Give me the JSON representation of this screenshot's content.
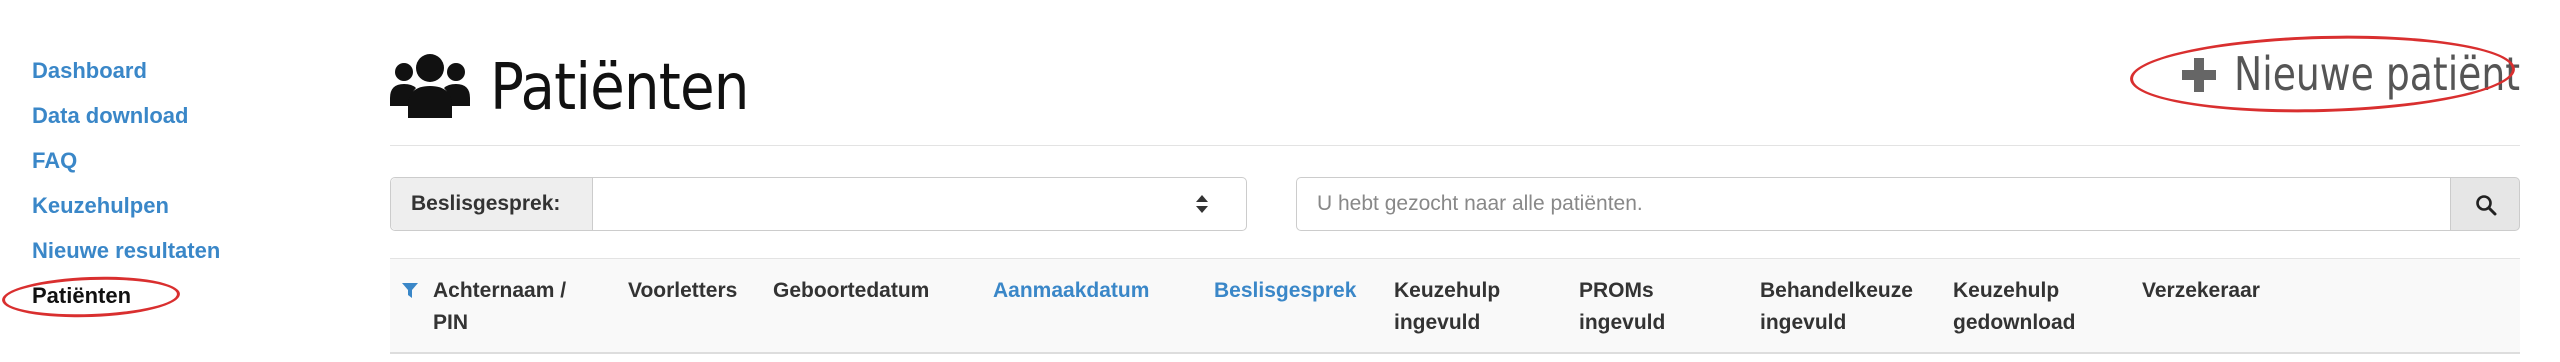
{
  "sidebar": {
    "items": [
      {
        "label": "Dashboard"
      },
      {
        "label": "Data download"
      },
      {
        "label": "FAQ"
      },
      {
        "label": "Keuzehulpen"
      },
      {
        "label": "Nieuwe resultaten"
      },
      {
        "label": "Patiënten",
        "active": true
      }
    ]
  },
  "header": {
    "title": "Patiënten",
    "icon": "users-icon",
    "new_patient_label": "Nieuwe patiënt"
  },
  "filter": {
    "label": "Beslisgesprek:",
    "selected": ""
  },
  "search": {
    "placeholder": "U hebt gezocht naar alle patiënten.",
    "value": ""
  },
  "table": {
    "columns": [
      {
        "line1": "Achternaam /",
        "line2": "PIN",
        "sortable": false,
        "filter_icon": true
      },
      {
        "line1": "Voorletters",
        "line2": "",
        "sortable": false
      },
      {
        "line1": "Geboortedatum",
        "line2": "",
        "sortable": false
      },
      {
        "line1": "Aanmaakdatum",
        "line2": "",
        "sortable": true
      },
      {
        "line1": "Beslisgesprek",
        "line2": "",
        "sortable": true
      },
      {
        "line1": "Keuzehulp",
        "line2": "ingevuld",
        "sortable": false
      },
      {
        "line1": "PROMs",
        "line2": "ingevuld",
        "sortable": false
      },
      {
        "line1": "Behandelkeuze",
        "line2": "ingevuld",
        "sortable": false
      },
      {
        "line1": "Keuzehulp",
        "line2": "gedownload",
        "sortable": false
      },
      {
        "line1": "Verzekeraar",
        "line2": "",
        "sortable": false
      }
    ]
  },
  "colors": {
    "link": "#3a87c8",
    "annotation": "#d92f2f",
    "text": "#333333"
  }
}
